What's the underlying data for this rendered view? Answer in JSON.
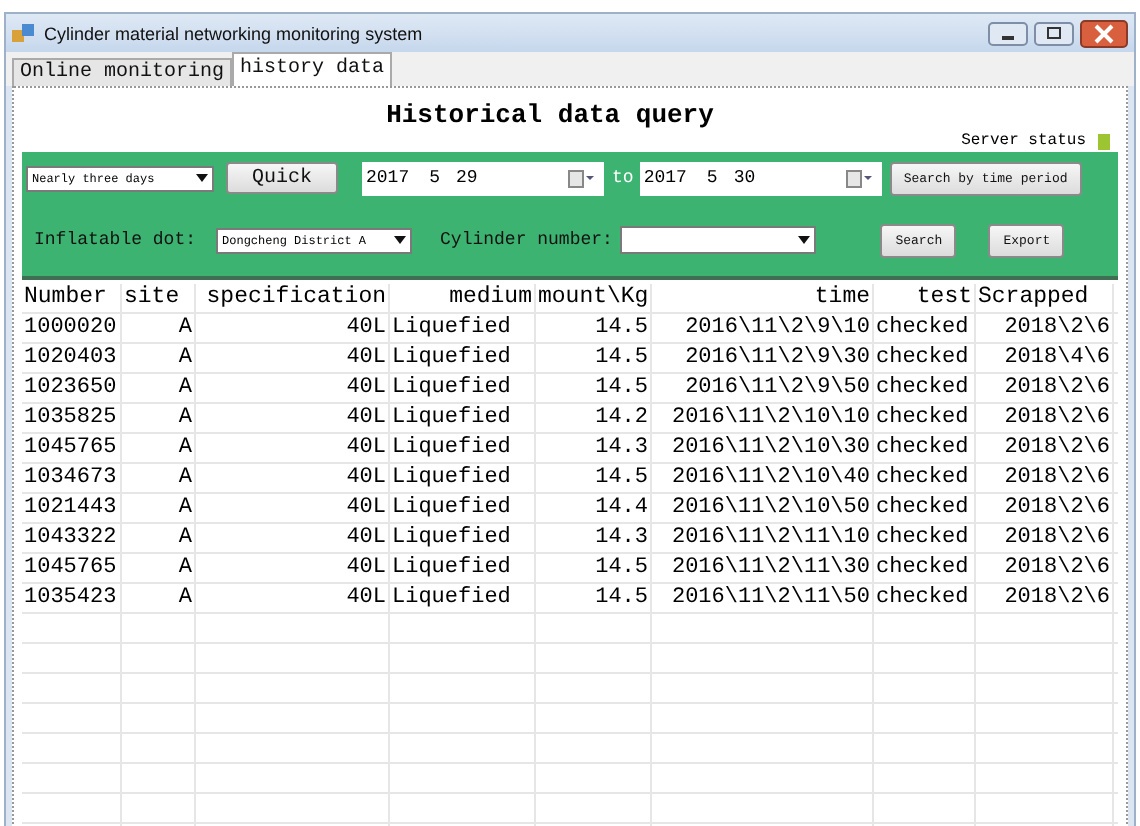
{
  "window": {
    "title": "Cylinder material networking monitoring system"
  },
  "tabs": [
    {
      "label": "Online monitoring",
      "selected": false
    },
    {
      "label": "history data",
      "selected": true
    }
  ],
  "heading": "Historical data query",
  "server_status": {
    "label": "Server status"
  },
  "toolbar": {
    "range": "Nearly three days",
    "quick": "Quick",
    "from": {
      "year": "2017",
      "month": "5",
      "day": "29"
    },
    "to_label": "to",
    "to": {
      "year": "2017",
      "month": "5",
      "day": "30"
    },
    "period_button": "Search by time period",
    "dot_label": "Inflatable dot:",
    "dot": "Dongcheng District A",
    "cylinder_label": "Cylinder number:",
    "search": "Search",
    "export": "Export"
  },
  "table": {
    "columns": [
      "Number",
      "site",
      "specification",
      "medium",
      "mount\\Kg",
      "time",
      "test",
      "Scrapped"
    ],
    "rows": [
      [
        "1000020",
        "A",
        "40L",
        "Liquefied",
        "14.5",
        "2016\\11\\2\\9\\10",
        "checked",
        "2018\\2\\6"
      ],
      [
        "1020403",
        "A",
        "40L",
        "Liquefied",
        "14.5",
        "2016\\11\\2\\9\\30",
        "checked",
        "2018\\4\\6"
      ],
      [
        "1023650",
        "A",
        "40L",
        "Liquefied",
        "14.5",
        "2016\\11\\2\\9\\50",
        "checked",
        "2018\\2\\6"
      ],
      [
        "1035825",
        "A",
        "40L",
        "Liquefied",
        "14.2",
        "2016\\11\\2\\10\\10",
        "checked",
        "2018\\2\\6"
      ],
      [
        "1045765",
        "A",
        "40L",
        "Liquefied",
        "14.3",
        "2016\\11\\2\\10\\30",
        "checked",
        "2018\\2\\6"
      ],
      [
        "1034673",
        "A",
        "40L",
        "Liquefied",
        "14.5",
        "2016\\11\\2\\10\\40",
        "checked",
        "2018\\2\\6"
      ],
      [
        "1021443",
        "A",
        "40L",
        "Liquefied",
        "14.4",
        "2016\\11\\2\\10\\50",
        "checked",
        "2018\\2\\6"
      ],
      [
        "1043322",
        "A",
        "40L",
        "Liquefied",
        "14.3",
        "2016\\11\\2\\11\\10",
        "checked",
        "2018\\2\\6"
      ],
      [
        "1045765",
        "A",
        "40L",
        "Liquefied",
        "14.5",
        "2016\\11\\2\\11\\30",
        "checked",
        "2018\\2\\6"
      ],
      [
        "1035423",
        "A",
        "40L",
        "Liquefied",
        "14.5",
        "2016\\11\\2\\11\\50",
        "checked",
        "2018\\2\\6"
      ]
    ]
  }
}
